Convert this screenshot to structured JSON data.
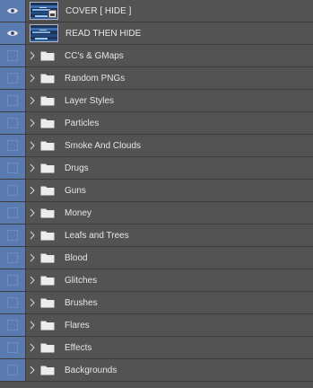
{
  "layers_panel": {
    "layers": [
      {
        "name": "COVER [ HIDE ]",
        "visible": true,
        "type": "smart-object"
      },
      {
        "name": "READ THEN HIDE",
        "visible": true,
        "type": "image"
      }
    ],
    "groups": [
      {
        "name": "CC's & GMaps",
        "visible": false
      },
      {
        "name": "Random PNGs",
        "visible": false
      },
      {
        "name": "Layer Styles",
        "visible": false
      },
      {
        "name": "Particles",
        "visible": false
      },
      {
        "name": "Smoke And Clouds",
        "visible": false
      },
      {
        "name": "Drugs",
        "visible": false
      },
      {
        "name": "Guns",
        "visible": false
      },
      {
        "name": "Money",
        "visible": false
      },
      {
        "name": "Leafs and Trees",
        "visible": false
      },
      {
        "name": "Blood",
        "visible": false
      },
      {
        "name": "Glitches",
        "visible": false
      },
      {
        "name": "Brushes",
        "visible": false
      },
      {
        "name": "Flares",
        "visible": false
      },
      {
        "name": "Effects",
        "visible": false
      },
      {
        "name": "Backgrounds",
        "visible": false
      }
    ],
    "icons": {
      "visibility_on": "eye-icon",
      "visibility_off": "empty-visibility-box",
      "expand": "chevron-right-icon",
      "group": "folder-icon"
    },
    "colors": {
      "panel_bg": "#535353",
      "visibility_column": "#5a7ab0",
      "row_divider": "#3c3c3c",
      "text": "#e6e6e6"
    }
  }
}
